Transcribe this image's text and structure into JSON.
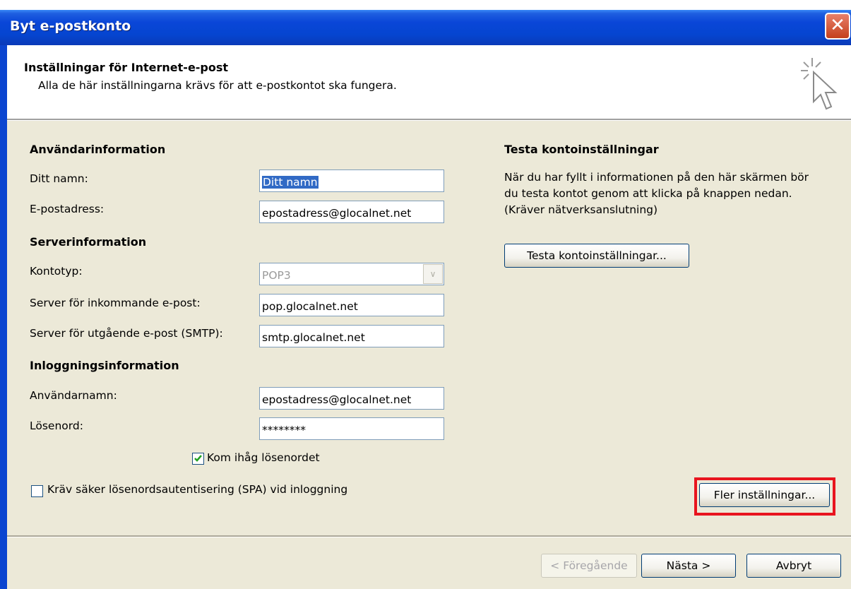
{
  "window": {
    "title": "Byt e-postkonto",
    "close_symbol": "✕"
  },
  "header": {
    "heading": "Inställningar för Internet-e-post",
    "subheading": "Alla de här inställningarna krävs för att e-postkontot ska fungera.",
    "icon": "cursor-sparkle-icon"
  },
  "user_info": {
    "title": "Användarinformation",
    "name_label": "Ditt namn:",
    "name_value": "Ditt namn",
    "email_label": "E-postadress:",
    "email_value": "epostadress@glocalnet.net"
  },
  "server_info": {
    "title": "Serverinformation",
    "account_type_label": "Kontotyp:",
    "account_type_value": "POP3",
    "incoming_label": "Server för inkommande e-post:",
    "incoming_value": "pop.glocalnet.net",
    "outgoing_label": "Server för utgående e-post (SMTP):",
    "outgoing_value": "smtp.glocalnet.net"
  },
  "login_info": {
    "title": "Inloggningsinformation",
    "username_label": "Användarnamn:",
    "username_value": "epostadress@glocalnet.net",
    "password_label": "Lösenord:",
    "password_value": "********",
    "remember_label": "Kom ihåg lösenordet",
    "remember_checked": true,
    "spa_label": "Kräv säker lösenordsautentisering (SPA) vid inloggning",
    "spa_checked": false
  },
  "test": {
    "title": "Testa kontoinställningar",
    "description_lines": [
      "När du har fyllt i informationen på den här skärmen bör",
      "du testa kontot genom att klicka på knappen nedan.",
      "(Kräver nätverksanslutning)"
    ],
    "button_label": "Testa kontoinställningar..."
  },
  "more_settings_label": "Fler inställningar...",
  "nav": {
    "back_label": "< Föregående",
    "next_label": "Nästa >",
    "cancel_label": "Avbryt"
  },
  "colors": {
    "titlebar": "#0545d0",
    "highlight": "#e8141e",
    "dialog_bg": "#ece9d8"
  }
}
